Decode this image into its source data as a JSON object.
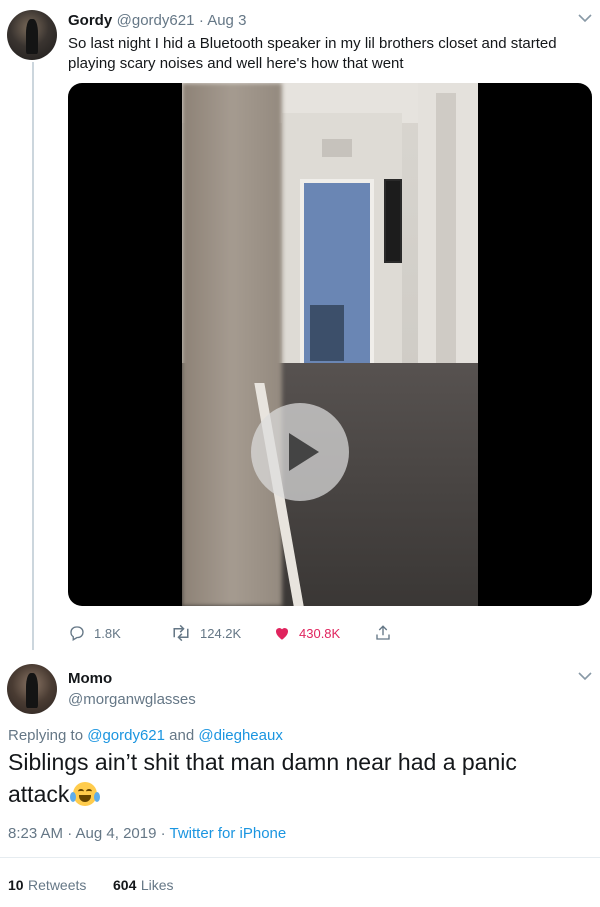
{
  "tweet1": {
    "display_name": "Gordy",
    "handle": "@gordy621",
    "date": "· Aug 3",
    "text": "So last night I hid a Bluetooth speaker in my lil brothers closet and started playing scary noises and well here's how that went",
    "actions": {
      "replies": "1.8K",
      "retweets": "124.2K",
      "likes": "430.8K"
    }
  },
  "tweet2": {
    "display_name": "Momo",
    "handle": "@morganwglasses",
    "replying_prefix": "Replying to",
    "replying_user1": "@gordy621",
    "replying_and": "and",
    "replying_user2": "@diegheaux",
    "text": "Siblings ain’t shit that man damn near had a panic attack",
    "timestamp": "8:23 AM · Aug 4, 2019 ·",
    "source": "Twitter for iPhone",
    "retweets_count": "10",
    "retweets_label": "Retweets",
    "likes_count": "604",
    "likes_label": "Likes"
  },
  "icons": {
    "reply": "reply-icon",
    "retweet": "retweet-icon",
    "like": "heart-icon",
    "share": "share-icon",
    "menu": "chevron-down-icon",
    "play": "play-icon",
    "emoji": "face-with-tears-of-joy-emoji"
  },
  "colors": {
    "accent": "#1b95e0",
    "like": "#e0245e",
    "muted": "#657786"
  }
}
